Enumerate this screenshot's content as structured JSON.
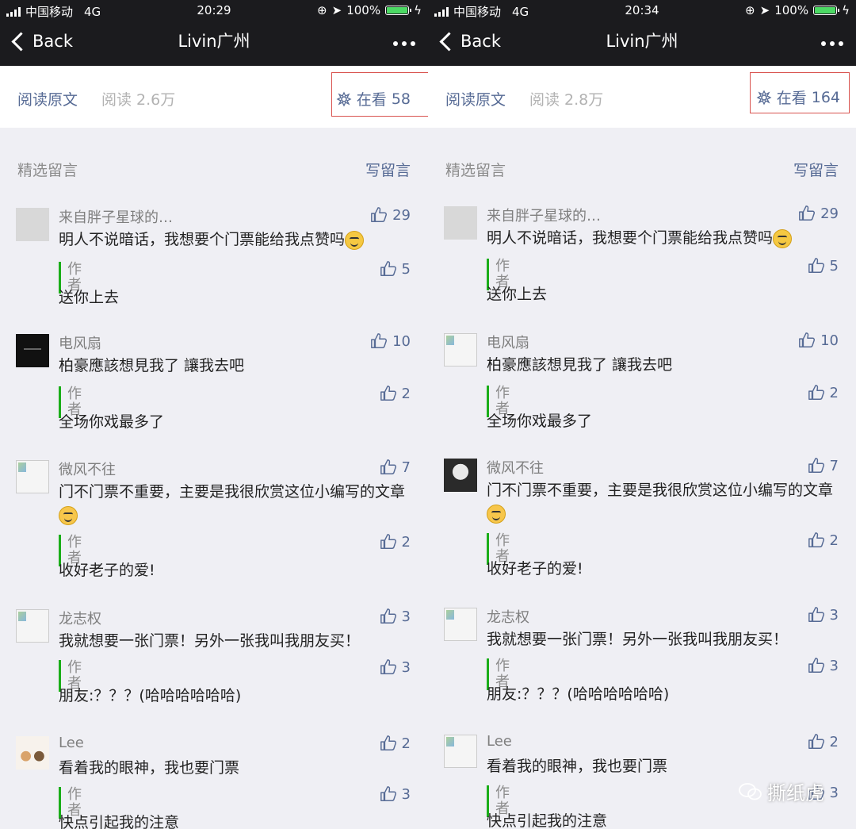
{
  "screens": [
    {
      "status": {
        "carrier": "中国移动",
        "network": "4G",
        "time": "20:29",
        "battery": "100%"
      },
      "nav": {
        "back": "Back",
        "title": "Livin广州"
      },
      "read": {
        "original": "阅读原文",
        "count": "阅读 2.6万",
        "zaikan": "在看",
        "zaikan_count": "58"
      },
      "comments_header": {
        "title": "精选留言",
        "write": "写留言"
      },
      "comments": [
        {
          "name": "来自胖子星球的…",
          "likes": "29",
          "text": "明人不说暗话，我想要个门票能给我点赞吗",
          "author_label": "作者",
          "reply_likes": "5",
          "reply": "送你上去"
        },
        {
          "name": "电风扇",
          "likes": "10",
          "text": "柏豪應該想見我了 讓我去吧",
          "author_label": "作者",
          "reply_likes": "2",
          "reply": "全场你戏最多了"
        },
        {
          "name": "微风不往",
          "likes": "7",
          "text": "门不门票不重要，主要是我很欣赏这位小编写的文章",
          "author_label": "作者",
          "reply_likes": "2",
          "reply": "收好老子的爱!"
        },
        {
          "name": "龙志权",
          "likes": "3",
          "text": "我就想要一张门票！另外一张我叫我朋友买！",
          "author_label": "作者",
          "reply_likes": "3",
          "reply": "朋友:？？？(哈哈哈哈哈哈)"
        },
        {
          "name": "Lee",
          "likes": "2",
          "text": "看着我的眼神，我也要门票",
          "author_label": "作者",
          "reply_likes": "3",
          "reply": "快点引起我的注意"
        }
      ]
    },
    {
      "status": {
        "carrier": "中国移动",
        "network": "4G",
        "time": "20:34",
        "battery": "100%"
      },
      "nav": {
        "back": "Back",
        "title": "Livin广州"
      },
      "read": {
        "original": "阅读原文",
        "count": "阅读 2.8万",
        "zaikan": "在看",
        "zaikan_count": "164"
      },
      "comments_header": {
        "title": "精选留言",
        "write": "写留言"
      },
      "comments": [
        {
          "name": "来自胖子星球的…",
          "likes": "29",
          "text": "明人不说暗话，我想要个门票能给我点赞吗",
          "author_label": "作者",
          "reply_likes": "5",
          "reply": "送你上去"
        },
        {
          "name": "电风扇",
          "likes": "10",
          "text": "柏豪應該想見我了 讓我去吧",
          "author_label": "作者",
          "reply_likes": "2",
          "reply": "全场你戏最多了"
        },
        {
          "name": "微风不往",
          "likes": "7",
          "text": "门不门票不重要，主要是我很欣赏这位小编写的文章",
          "author_label": "作者",
          "reply_likes": "2",
          "reply": "收好老子的爱!"
        },
        {
          "name": "龙志权",
          "likes": "3",
          "text": "我就想要一张门票！另外一张我叫我朋友买！",
          "author_label": "作者",
          "reply_likes": "3",
          "reply": "朋友:？？？(哈哈哈哈哈哈)"
        },
        {
          "name": "Lee",
          "likes": "2",
          "text": "看着我的眼神，我也要门票",
          "author_label": "作者",
          "reply_likes": "3",
          "reply": "快点引起我的注意"
        }
      ]
    }
  ],
  "watermark": "撕纸虎",
  "colors": {
    "link": "#576b95",
    "author_bar": "#1aad19",
    "highlight_box": "#d9534f",
    "nav_bg": "#1b1b1e"
  }
}
